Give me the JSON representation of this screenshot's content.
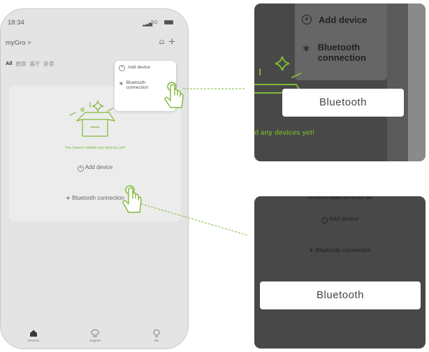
{
  "status_bar": {
    "time": "18:34",
    "network": "5G"
  },
  "header": {
    "home_name": "myGro >"
  },
  "rooms": [
    "All",
    "厨房",
    "客厅",
    "卧室"
  ],
  "popup_menu": {
    "add_device": "Add device",
    "bluetooth_line1": "Bluetooth",
    "bluetooth_line2": "connection"
  },
  "empty_state": {
    "message": "You haven't added any devices yet!",
    "add_device": "Add device",
    "bluetooth_connection": "Bluetooth connection"
  },
  "tabs": {
    "devices": "Devices",
    "support": "Support",
    "me": "Me"
  },
  "zoom_top": {
    "add_device": "Add device",
    "bluetooth_line1": "Bluetooth",
    "bluetooth_line2": "connection",
    "empty_text": "d any devices yet!",
    "callout": "Bluetooth"
  },
  "zoom_bottom": {
    "empty_text": "You haven't added any devices yet!",
    "add_device": "Add device",
    "bluetooth_connection": "Bluetooth connection",
    "callout": "Bluetooth"
  },
  "colors": {
    "accent_green": "#7fb83a",
    "dark_panel": "#484848"
  },
  "icons": [
    "plus-circle-icon",
    "bluetooth-icon",
    "bell-icon",
    "plus-icon",
    "empty-box-icon",
    "tap-hand-icon",
    "home-icon",
    "support-icon",
    "me-icon"
  ]
}
